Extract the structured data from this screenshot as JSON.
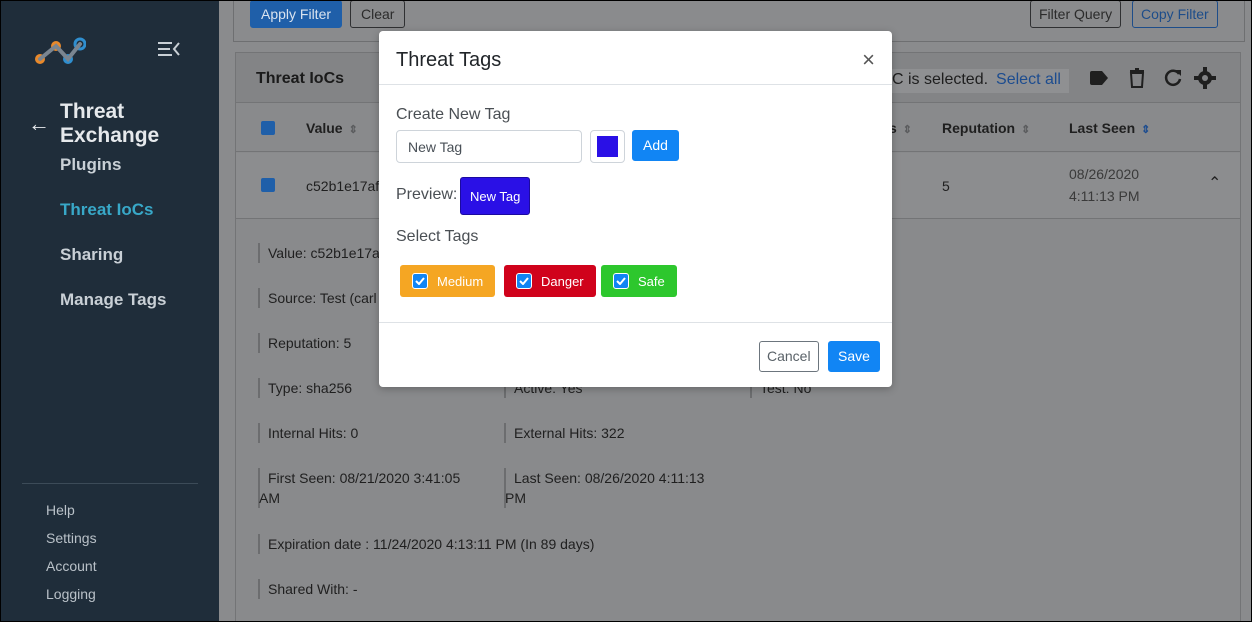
{
  "sidebar": {
    "app_title": "Threat Exchange",
    "nav": [
      "Plugins",
      "Threat IoCs",
      "Sharing",
      "Manage Tags"
    ],
    "active_nav": "Threat IoCs",
    "bottom": [
      "Help",
      "Settings",
      "Account",
      "Logging"
    ]
  },
  "toolbar": {
    "apply_filter": "Apply Filter",
    "clear": "Clear",
    "filter_query": "Filter Query",
    "copy_filter": "Copy Filter"
  },
  "card": {
    "title": "Threat IoCs",
    "selected_text": "C is selected.",
    "select_all": "Select all"
  },
  "table": {
    "headers": {
      "value": "Value",
      "hits_partial": "s",
      "reputation": "Reputation",
      "last_seen": "Last Seen"
    },
    "row": {
      "value": "c52b1e17af",
      "reputation": "5",
      "last_seen_date": "08/26/2020",
      "last_seen_time": "4:11:13 PM"
    }
  },
  "details": {
    "value": "Value:  c52b1e17a",
    "source": "Source:  Test (carl",
    "reputation": "Reputation:  5",
    "type": "Type:  sha256",
    "active": "Active:  Yes",
    "test": "Test:  No",
    "internal_hits": "Internal Hits:  0",
    "external_hits": "External Hits:  322",
    "first_seen_1": "First Seen:  08/21/2020 3:41:05",
    "first_seen_2": "AM",
    "last_seen_1": "Last Seen:  08/26/2020 4:11:13",
    "last_seen_2": "PM",
    "expiration": "Expiration date :  11/24/2020 4:13:11 PM (In 89 days)",
    "shared_with": "Shared With:  -"
  },
  "modal": {
    "title": "Threat Tags",
    "close": "×",
    "create_label": "Create New Tag",
    "input_value": "New Tag",
    "picker_color": "#2a10e6",
    "add": "Add",
    "preview_label": "Preview:",
    "preview_tag": "New Tag",
    "select_label": "Select Tags",
    "tags": [
      {
        "label": "Medium",
        "color": "#f5a623"
      },
      {
        "label": "Danger",
        "color": "#d0021b"
      },
      {
        "label": "Safe",
        "color": "#2dc72d"
      }
    ],
    "cancel": "Cancel",
    "save": "Save"
  }
}
